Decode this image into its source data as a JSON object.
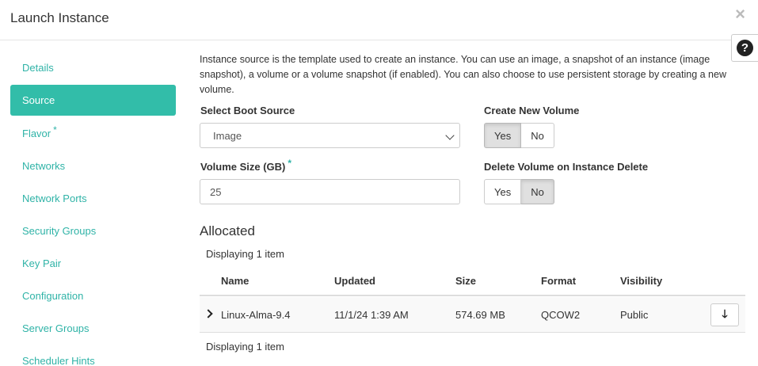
{
  "modal": {
    "title": "Launch Instance",
    "close_glyph": "×",
    "help_glyph": "?"
  },
  "nav": {
    "items": [
      {
        "label": "Details"
      },
      {
        "label": "Source"
      },
      {
        "label": "Flavor",
        "required": "*"
      },
      {
        "label": "Networks"
      },
      {
        "label": "Network Ports"
      },
      {
        "label": "Security Groups"
      },
      {
        "label": "Key Pair"
      },
      {
        "label": "Configuration"
      },
      {
        "label": "Server Groups"
      },
      {
        "label": "Scheduler Hints"
      }
    ]
  },
  "source": {
    "intro": "Instance source is the template used to create an instance. You can use an image, a snapshot of an instance (image snapshot), a volume or a volume snapshot (if enabled). You can also choose to use persistent storage by creating a new volume.",
    "boot_source_label": "Select Boot Source",
    "boot_source_value": "Image",
    "volume_size_label": "Volume Size (GB)",
    "volume_size_required": "*",
    "volume_size_value": "25",
    "create_volume_label": "Create New Volume",
    "create_volume_yes": "Yes",
    "create_volume_no": "No",
    "delete_volume_label": "Delete Volume on Instance Delete",
    "delete_volume_yes": "Yes",
    "delete_volume_no": "No"
  },
  "allocated": {
    "title": "Allocated",
    "displaying_top": "Displaying 1 item",
    "displaying_bottom": "Displaying 1 item",
    "columns": [
      "Name",
      "Updated",
      "Size",
      "Format",
      "Visibility"
    ],
    "rows": [
      {
        "name": "Linux-Alma-9.4",
        "updated": "11/1/24 1:39 AM",
        "size": "574.69 MB",
        "format": "QCOW2",
        "visibility": "Public",
        "action_glyph": "🡓"
      }
    ]
  },
  "colors": {
    "accent": "#32bda9",
    "link": "#2fb3a7"
  }
}
